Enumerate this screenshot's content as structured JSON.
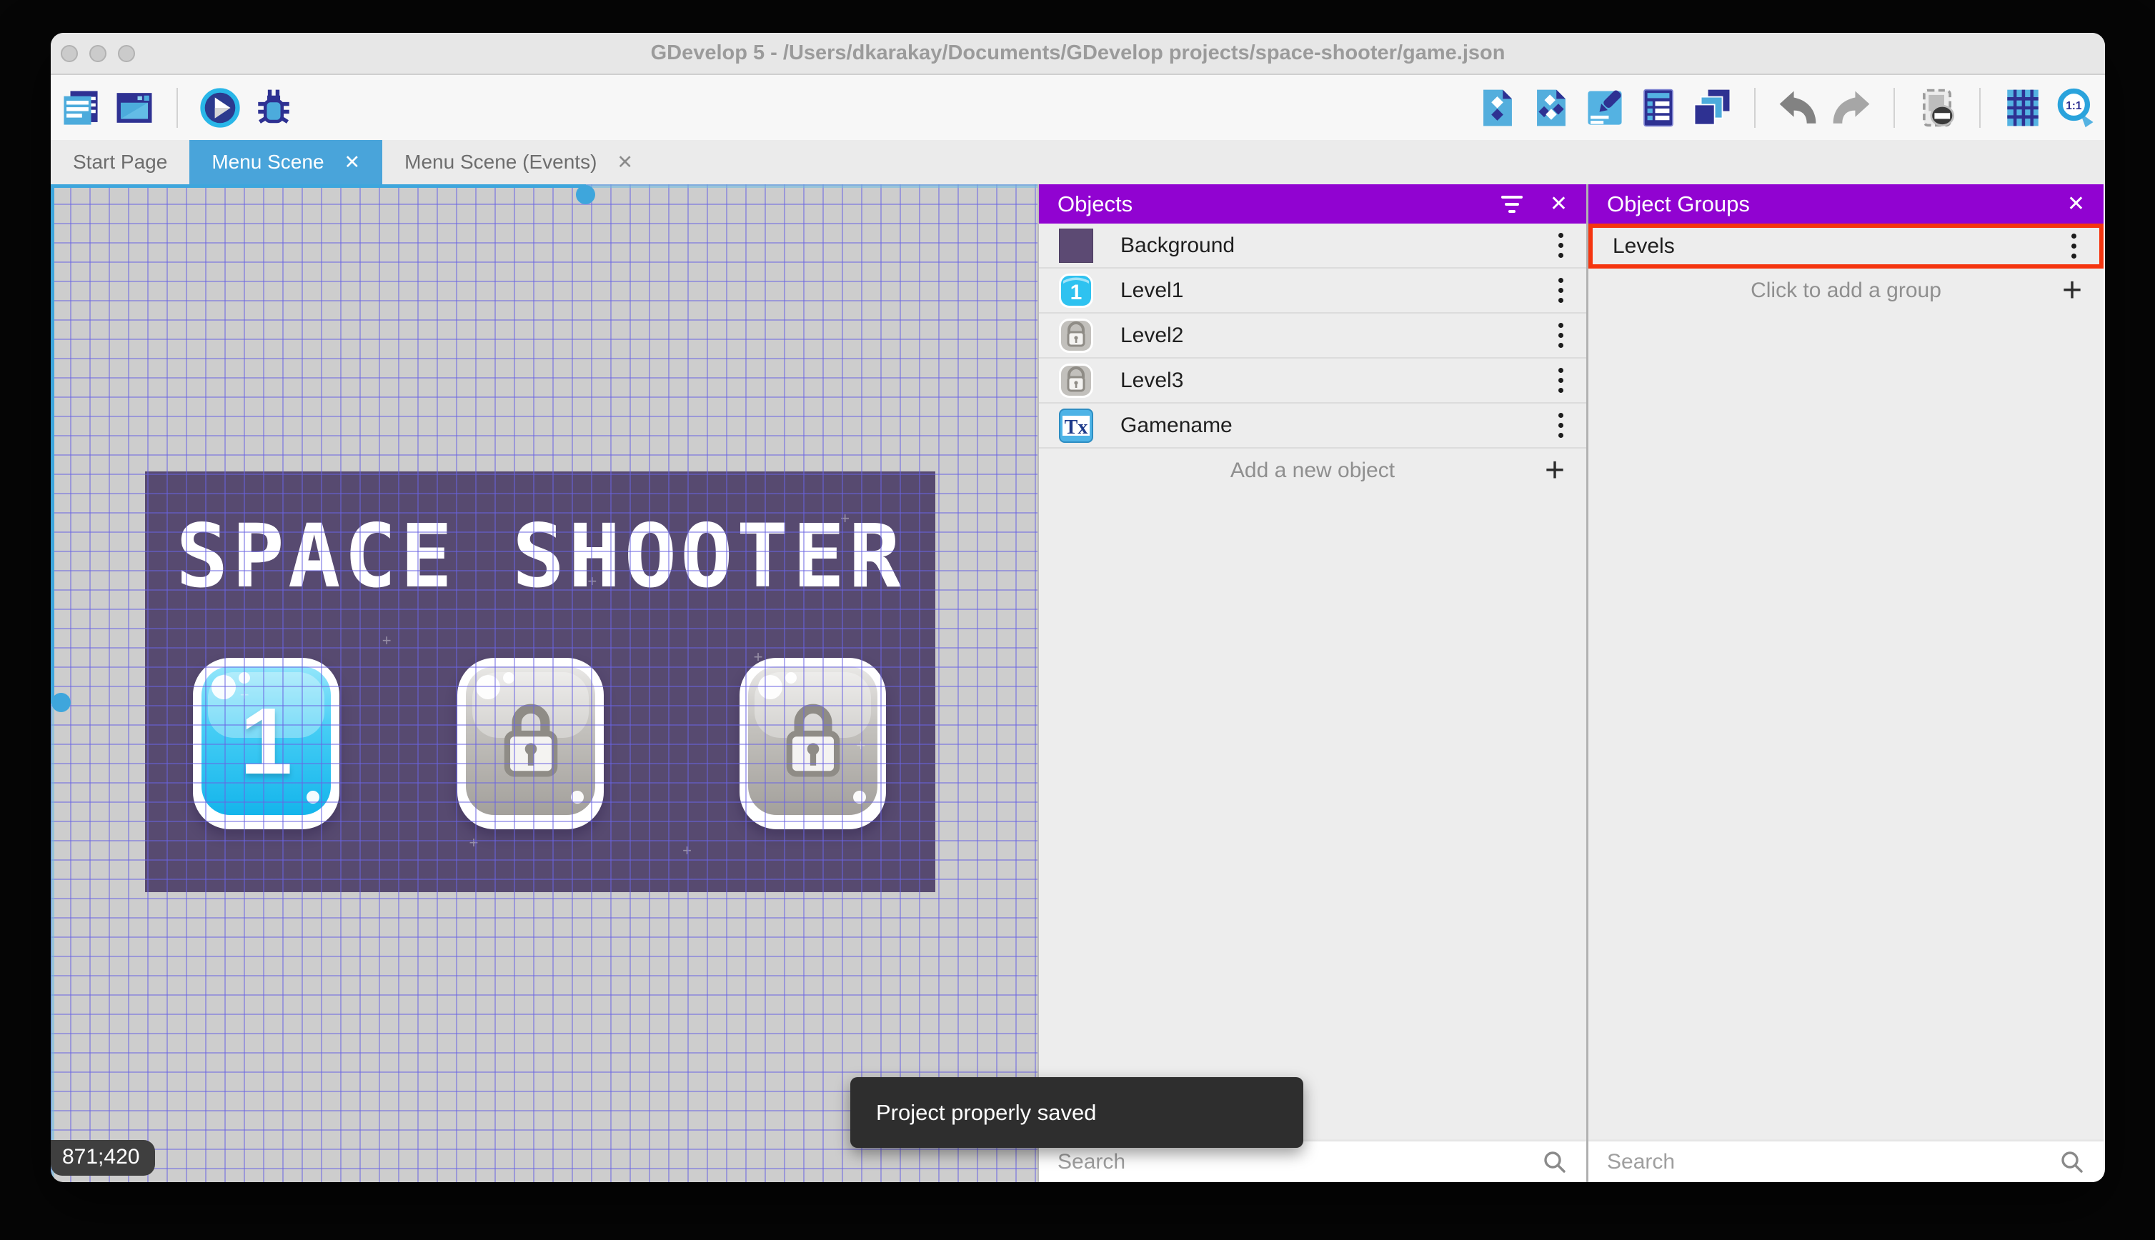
{
  "window": {
    "title": "GDevelop 5 - /Users/dkarakay/Documents/GDevelop projects/space-shooter/game.json"
  },
  "toolbar": {
    "left_icons": [
      "project-manager-icon",
      "scene-editor-icon",
      "play-icon",
      "debug-icon"
    ],
    "right_icons": [
      "object-icon",
      "instances-icon",
      "edit-scene-icon",
      "properties-icon",
      "layers-icon",
      "undo-icon",
      "redo-icon",
      "mask-icon",
      "grid-icon",
      "zoom-1-1-icon"
    ],
    "zoom_label": "1:1"
  },
  "tabs": [
    {
      "label": "Start Page",
      "active": false
    },
    {
      "label": "Menu Scene",
      "active": true,
      "close_glyph": "✕"
    },
    {
      "label": "Menu Scene (Events)",
      "active": false,
      "close_glyph": "✕"
    }
  ],
  "canvas": {
    "coordinates": "871;420",
    "scene": {
      "title": "SPACE SHOOTER",
      "buttons": [
        {
          "label": "1",
          "state": "unlocked"
        },
        {
          "state": "locked",
          "icon": "lock-icon"
        },
        {
          "state": "locked",
          "icon": "lock-icon"
        }
      ]
    }
  },
  "objects_panel": {
    "title": "Objects",
    "close_glyph": "✕",
    "plus_glyph": "+",
    "icons": [
      "filter-icon",
      "close-icon",
      "kebab-menu-icon",
      "search-icon"
    ],
    "items": [
      {
        "name": "Background",
        "icon": "background-swatch"
      },
      {
        "name": "Level1",
        "icon": "level1-button-icon",
        "icon_text": "1"
      },
      {
        "name": "Level2",
        "icon": "lock-button-icon"
      },
      {
        "name": "Level3",
        "icon": "lock-button-icon"
      },
      {
        "name": "Gamename",
        "icon": "text-object-icon",
        "icon_text": "Tx"
      }
    ],
    "add_label": "Add a new object",
    "search_placeholder": "Search"
  },
  "object_groups_panel": {
    "title": "Object Groups",
    "close_glyph": "✕",
    "plus_glyph": "+",
    "groups": [
      {
        "name": "Levels",
        "highlighted": true
      }
    ],
    "add_label": "Click to add a group",
    "search_placeholder": "Search"
  },
  "toast": {
    "message": "Project properly saved"
  },
  "colors": {
    "panel_header_purple": "#9103d1",
    "active_tab_blue": "#49a4da",
    "selection_blue": "#3ea6dc",
    "highlight_red": "#f5350f",
    "scene_purple": "#574a70",
    "toast_bg": "#2e2e2e"
  }
}
